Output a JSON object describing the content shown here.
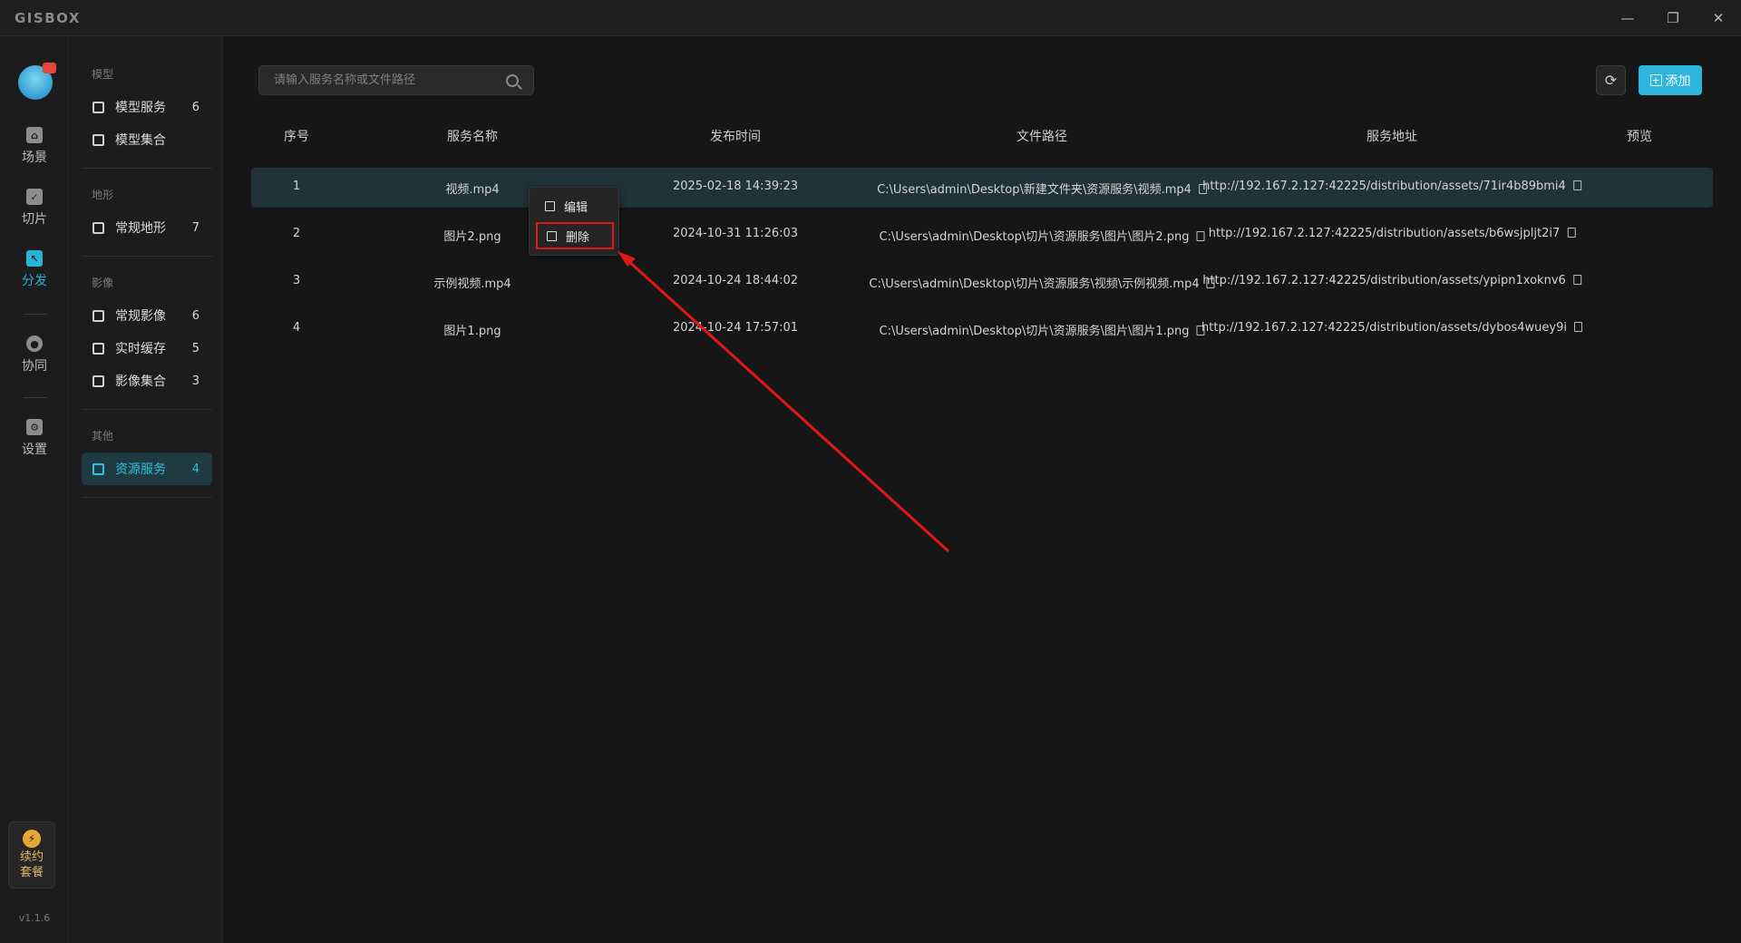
{
  "app": {
    "logo": "GISBOX",
    "minimize": "—",
    "restore": "❐",
    "close": "✕",
    "version": "v1.1.6"
  },
  "rail": {
    "items": [
      {
        "label": "场景",
        "icon": "home-icon"
      },
      {
        "label": "切片",
        "icon": "slice-icon"
      },
      {
        "label": "分发",
        "icon": "distribute-icon",
        "active": true
      },
      {
        "label": "协同",
        "icon": "collab-icon"
      },
      {
        "label": "设置",
        "icon": "settings-icon"
      }
    ],
    "renew_line1": "续约",
    "renew_line2": "套餐",
    "renew_icon": "⚡"
  },
  "sidebar": {
    "sections": [
      {
        "title": "模型",
        "items": [
          {
            "label": "模型服务",
            "count": "6"
          },
          {
            "label": "模型集合",
            "count": ""
          }
        ]
      },
      {
        "title": "地形",
        "items": [
          {
            "label": "常规地形",
            "count": "7"
          }
        ]
      },
      {
        "title": "影像",
        "items": [
          {
            "label": "常规影像",
            "count": "6"
          },
          {
            "label": "实时缓存",
            "count": "5"
          },
          {
            "label": "影像集合",
            "count": "3"
          }
        ]
      },
      {
        "title": "其他",
        "items": [
          {
            "label": "资源服务",
            "count": "4",
            "active": true
          }
        ]
      }
    ]
  },
  "toolbar": {
    "search_placeholder": "请输入服务名称或文件路径",
    "refresh_icon": "⟳",
    "add_label": "添加",
    "add_icon": "+"
  },
  "table": {
    "headers": [
      "序号",
      "服务名称",
      "发布时间",
      "文件路径",
      "服务地址",
      "预览"
    ],
    "rows": [
      [
        "1",
        "视频.mp4",
        "2025-02-18 14:39:23",
        "C:\\Users\\admin\\Desktop\\新建文件夹\\资源服务\\视频.mp4",
        "http://192.167.2.127:42225/distribution/assets/71ir4b89bmi4"
      ],
      [
        "2",
        "图片2.png",
        "2024-10-31 11:26:03",
        "C:\\Users\\admin\\Desktop\\切片\\资源服务\\图片\\图片2.png",
        "http://192.167.2.127:42225/distribution/assets/b6wsjpljt2i7"
      ],
      [
        "3",
        "示例视频.mp4",
        "2024-10-24 18:44:02",
        "C:\\Users\\admin\\Desktop\\切片\\资源服务\\视频\\示例视频.mp4",
        "http://192.167.2.127:42225/distribution/assets/ypipn1xoknv6"
      ],
      [
        "4",
        "图片1.png",
        "2024-10-24 17:57:01",
        "C:\\Users\\admin\\Desktop\\切片\\资源服务\\图片\\图片1.png",
        "http://192.167.2.127:42225/distribution/assets/dybos4wuey9i"
      ]
    ]
  },
  "context_menu": {
    "edit": "编辑",
    "delete": "删除"
  },
  "colors": {
    "accent": "#2cb6dd",
    "annotation": "#e01818"
  }
}
